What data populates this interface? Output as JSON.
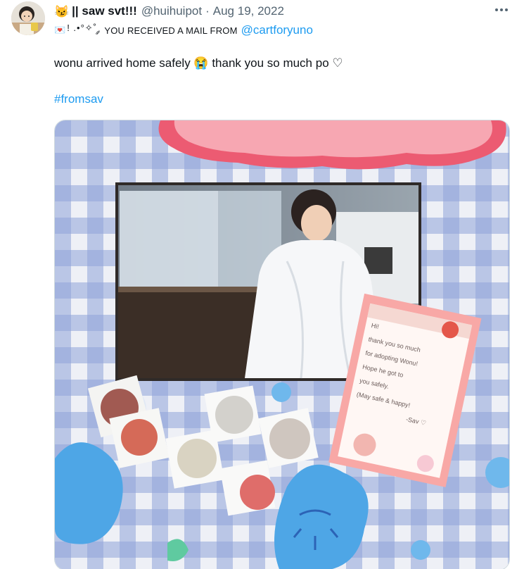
{
  "author": {
    "emoji": "😼",
    "display_name": "|| saw svt!!!",
    "handle": "@huihuipot",
    "separator": "·",
    "date": "Aug 19, 2022"
  },
  "subline": {
    "envelope_emoji": "💌",
    "deco": "! .•°✧˚ ༘",
    "text": "YOU RECEIVED A MAIL FROM",
    "mention": "@cartforyuno"
  },
  "tweet": {
    "text": "wonu arrived home safely 😭 thank you so much po ♡",
    "hashtag": "#fromsav"
  },
  "photo": {
    "letter_lines": [
      "Hi!",
      "thank you so much",
      "for adopting Wonu!",
      "Hope he got to",
      "you safely.",
      "(May safe & happy!",
      "-Sav ♡"
    ]
  },
  "colors": {
    "link": "#1d9bf0",
    "text": "#0f1419",
    "muted": "#536471"
  }
}
